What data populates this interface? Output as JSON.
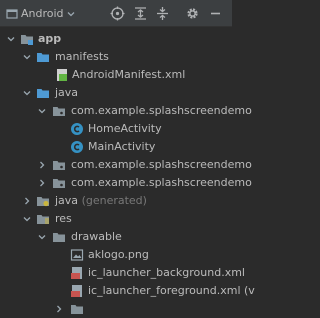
{
  "toolbar": {
    "view_label": "Android",
    "icons": [
      "view-dropdown-icon",
      "locate-target-icon",
      "expand-all-icon",
      "collapse-all-icon",
      "gear-icon",
      "hide-dash-icon"
    ]
  },
  "tree": {
    "app": "app",
    "manifests": "manifests",
    "manifest_file": "AndroidManifest.xml",
    "java": "java",
    "pkg_main": "com.example.splashscreendemo",
    "home_activity": "HomeActivity",
    "main_activity": "MainActivity",
    "pkg_2": "com.example.splashscreendemo",
    "pkg_3": "com.example.splashscreendemo",
    "java_generated": "java",
    "java_generated_suffix": "(generated)",
    "res": "res",
    "drawable": "drawable",
    "aklogo": "aklogo.png",
    "ic_bg": "ic_launcher_background.xml",
    "ic_fg": "ic_launcher_foreground.xml (v",
    "last_partial": "..."
  },
  "colors": {
    "background": "#2b2b2b",
    "toolbar": "#3c3f41",
    "folder": "#87939a",
    "source_folder": "#4e9ad4",
    "class_icon": "#3592c4",
    "xml_icon": "#c75450",
    "text": "#bbbbbb"
  }
}
